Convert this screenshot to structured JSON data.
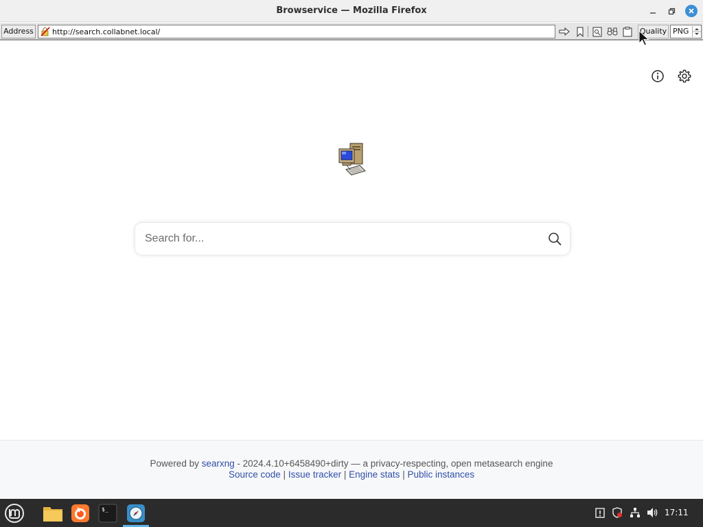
{
  "window": {
    "title": "Browservice — Mozilla Firefox"
  },
  "toolbar": {
    "address_label": "Address",
    "url": "http://search.collabnet.local/",
    "quality_label": "Quality",
    "quality_value": "PNG",
    "icons": [
      "go-arrow-icon",
      "bookmark-icon",
      "find-icon",
      "binoculars-icon",
      "clipboard-icon"
    ]
  },
  "search": {
    "placeholder": "Search for..."
  },
  "footer": {
    "powered_prefix": "Powered by",
    "engine_link": "searxng",
    "version_text": "- 2024.4.10+6458490+dirty — a privacy-respecting, open metasearch engine",
    "links": [
      {
        "label": "Source code"
      },
      {
        "label": "Issue tracker"
      },
      {
        "label": "Engine stats"
      },
      {
        "label": "Public instances"
      }
    ],
    "separator": "|"
  },
  "taskbar": {
    "clock": "17:11",
    "apps": [
      "mint-menu-icon",
      "files-icon",
      "firefox-icon",
      "terminal-icon",
      "browser-icon"
    ],
    "tray": [
      "clipboard-tray-icon",
      "shield-tray-icon",
      "network-tray-icon",
      "volume-tray-icon"
    ]
  },
  "colors": {
    "link": "#3050a8",
    "taskbar": "#2b2b2b",
    "accent": "#3d8fd6"
  }
}
